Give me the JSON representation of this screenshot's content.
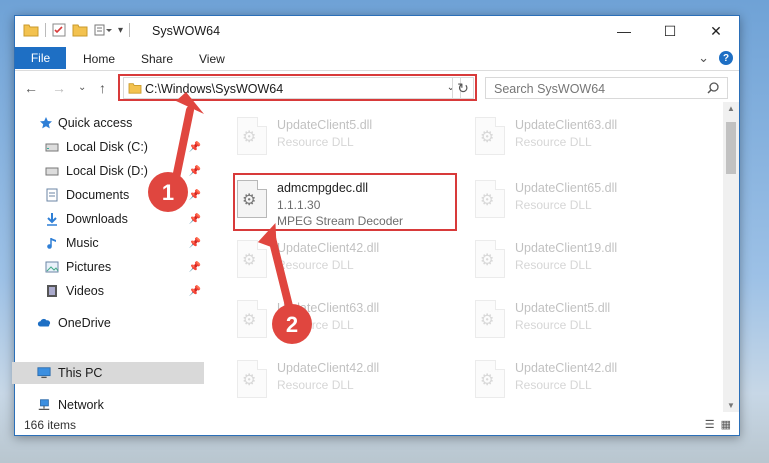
{
  "window": {
    "title": "SysWOW64",
    "min_glyph": "—",
    "max_glyph": "☐",
    "close_glyph": "✕"
  },
  "ribbon": {
    "file_tab": "File",
    "tabs": [
      "Home",
      "Share",
      "View"
    ],
    "expand_glyph": "⌄",
    "help_glyph": "?"
  },
  "nav": {
    "back_glyph": "←",
    "forward_glyph": "→",
    "recent_glyph": "⌄",
    "up_glyph": "↑",
    "address": "C:\\Windows\\SysWOW64",
    "address_drop_glyph": "⌄",
    "refresh_glyph": "↻",
    "search_placeholder": "Search SysWOW64"
  },
  "sidebar": {
    "items": [
      {
        "label": "Quick access",
        "icon": "star-icon",
        "pinned": false
      },
      {
        "label": "Local Disk (C:)",
        "icon": "drive-icon",
        "pinned": true
      },
      {
        "label": "Local Disk (D:)",
        "icon": "drive-icon",
        "pinned": true
      },
      {
        "label": "Documents",
        "icon": "documents-icon",
        "pinned": true
      },
      {
        "label": "Downloads",
        "icon": "download-icon",
        "pinned": true
      },
      {
        "label": "Music",
        "icon": "music-icon",
        "pinned": true
      },
      {
        "label": "Pictures",
        "icon": "pictures-icon",
        "pinned": true
      },
      {
        "label": "Videos",
        "icon": "videos-icon",
        "pinned": true
      },
      {
        "label": "OneDrive",
        "icon": "cloud-icon",
        "pinned": false
      },
      {
        "label": "This PC",
        "icon": "computer-icon",
        "pinned": false,
        "selected": true
      },
      {
        "label": "Network",
        "icon": "network-icon",
        "pinned": false
      }
    ]
  },
  "files": {
    "left": [
      {
        "name": "UpdateClient5.dll",
        "desc": "Resource DLL",
        "faded": true
      },
      {
        "name": "admcmpgdec.dll",
        "version": "1.1.1.30",
        "desc": "MPEG Stream Decoder",
        "faded": false,
        "highlighted": true
      },
      {
        "name": "UpdateClient42.dll",
        "desc": "Resource DLL",
        "faded": true
      },
      {
        "name": "UpdateClient63.dll",
        "desc": "Resource DLL",
        "faded": true
      },
      {
        "name": "UpdateClient42.dll",
        "desc": "Resource DLL",
        "faded": true
      }
    ],
    "right": [
      {
        "name": "UpdateClient63.dll",
        "desc": "Resource DLL",
        "faded": true
      },
      {
        "name": "UpdateClient65.dll",
        "desc": "Resource DLL",
        "faded": true
      },
      {
        "name": "UpdateClient19.dll",
        "desc": "Resource DLL",
        "faded": true
      },
      {
        "name": "UpdateClient5.dll",
        "desc": "Resource DLL",
        "faded": true
      },
      {
        "name": "UpdateClient42.dll",
        "desc": "Resource DLL",
        "faded": true
      }
    ]
  },
  "status": {
    "item_count": "166 items"
  },
  "annotations": {
    "step1": "1",
    "step2": "2",
    "color": "#e0463f"
  }
}
